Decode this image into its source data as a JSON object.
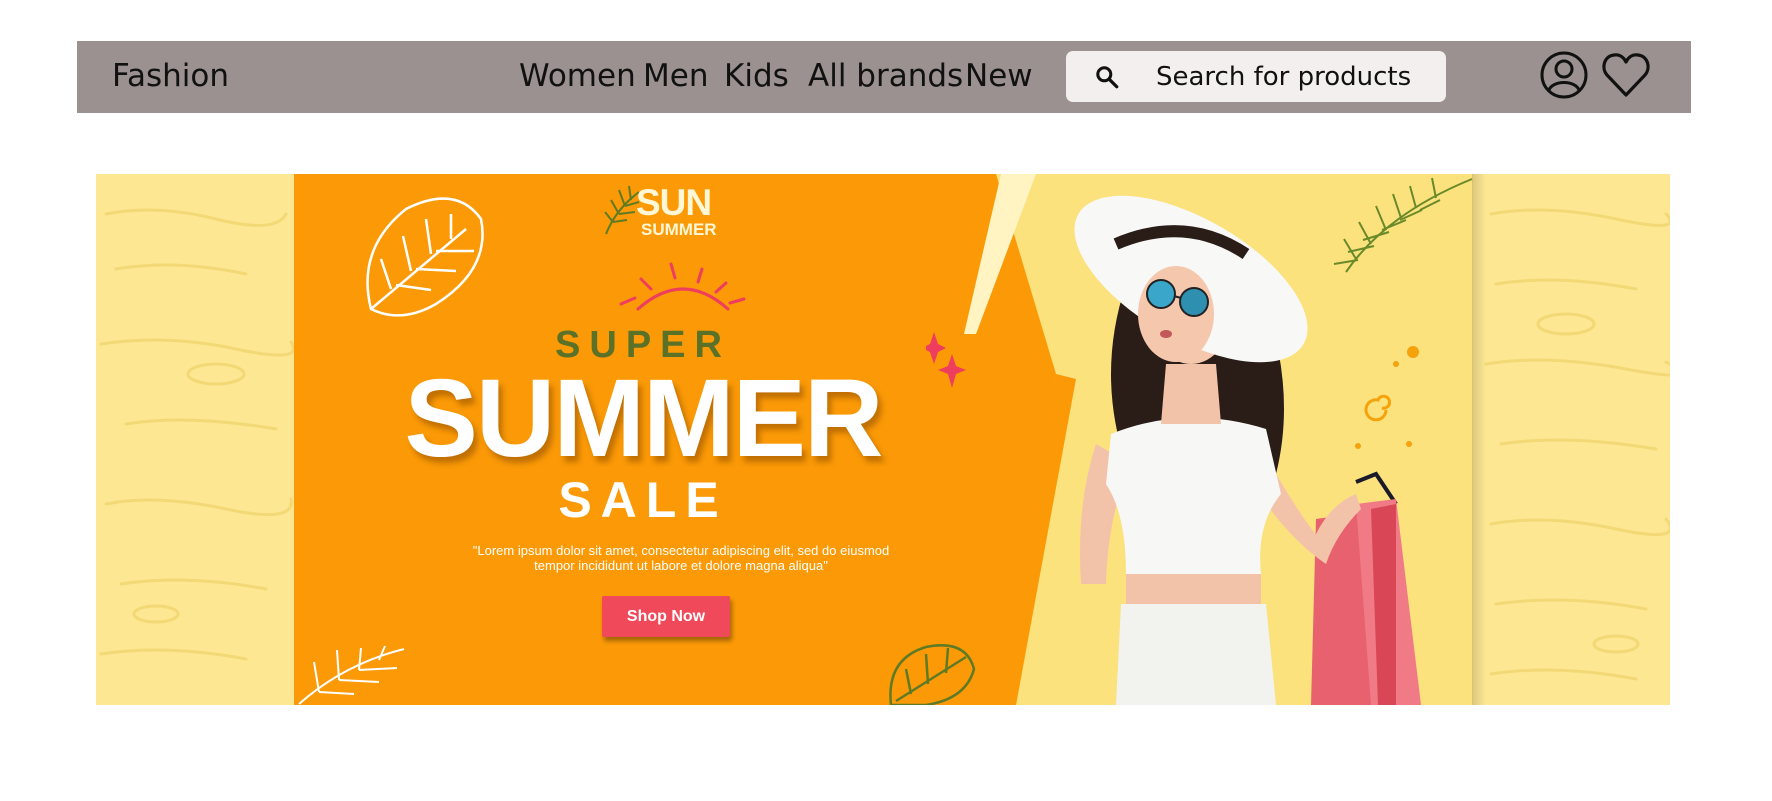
{
  "header": {
    "brand": "Fashion",
    "nav": [
      "Women",
      "Men",
      "Kids",
      "All brands",
      "New"
    ],
    "search": {
      "placeholder": "Search for products",
      "value": ""
    },
    "icons": [
      "search-icon",
      "account-icon",
      "heart-icon"
    ]
  },
  "banner": {
    "logo_line1": "SUN",
    "logo_line2": "SUMMER",
    "headline_top": "SUPER",
    "headline_main": "SUMMER",
    "headline_bottom": "SALE",
    "body_text": "\"Lorem ipsum dolor sit amet, consectetur adipiscing elit, sed do eiusmod tempor incididunt ut labore et dolore magna aliqua\"",
    "cta": "Shop Now"
  },
  "colors": {
    "navbar": "#9a9190",
    "search_bg": "#f3efee",
    "banner_orange": "#fb9a06",
    "banner_yellow": "#fde793",
    "accent_green": "#5b7127",
    "cta_red": "#f0495a"
  }
}
